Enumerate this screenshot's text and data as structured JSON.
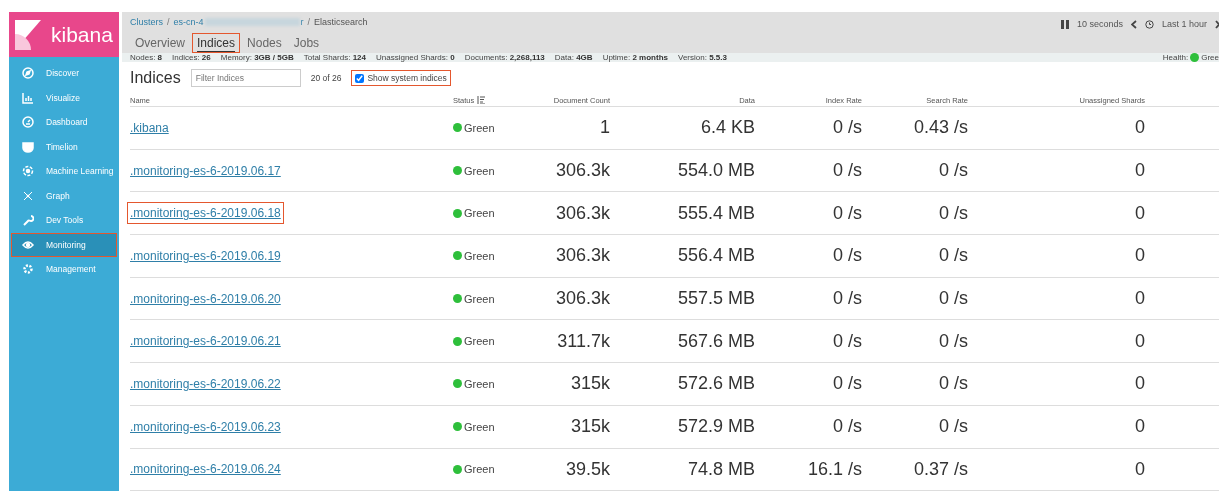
{
  "sidebar": {
    "logo": "kibana",
    "items": [
      {
        "label": "Discover",
        "selected": false,
        "highlighted": false
      },
      {
        "label": "Visualize",
        "selected": false,
        "highlighted": false
      },
      {
        "label": "Dashboard",
        "selected": false,
        "highlighted": false
      },
      {
        "label": "Timelion",
        "selected": false,
        "highlighted": false
      },
      {
        "label": "Machine Learning",
        "selected": false,
        "highlighted": false
      },
      {
        "label": "Graph",
        "selected": false,
        "highlighted": false
      },
      {
        "label": "Dev Tools",
        "selected": false,
        "highlighted": false
      },
      {
        "label": "Monitoring",
        "selected": true,
        "highlighted": true
      },
      {
        "label": "Management",
        "selected": false,
        "highlighted": false
      }
    ]
  },
  "breadcrumbs": [
    {
      "label": "Clusters",
      "kind": "link"
    },
    {
      "separator": "/",
      "label": "es-cn-4",
      "suffix": "r",
      "kind": "redacted"
    },
    {
      "separator": "/",
      "label": "Elasticsearch",
      "kind": "current"
    }
  ],
  "tabs": [
    {
      "label": "Overview",
      "selected": false,
      "highlighted": false
    },
    {
      "label": "Indices",
      "selected": true,
      "highlighted": true
    },
    {
      "label": "Nodes",
      "selected": false,
      "highlighted": false
    },
    {
      "label": "Jobs",
      "selected": false,
      "highlighted": false
    }
  ],
  "time_controls": {
    "refresh": "10 seconds",
    "range": "Last 1 hour"
  },
  "stats": [
    {
      "label": "Nodes:",
      "value": "8"
    },
    {
      "label": "Indices:",
      "value": "26"
    },
    {
      "label": "Memory:",
      "value": "3GB / 5GB"
    },
    {
      "label": "Total Shards:",
      "value": "124"
    },
    {
      "label": "Unassigned Shards:",
      "value": "0"
    },
    {
      "label": "Documents:",
      "value": "2,268,113"
    },
    {
      "label": "Data:",
      "value": "4GB"
    },
    {
      "label": "Uptime:",
      "value": "2 months"
    },
    {
      "label": "Version:",
      "value": "5.5.3"
    }
  ],
  "health": {
    "label": "Health:",
    "value": "Gree",
    "color": "#2ebf3b"
  },
  "indices": {
    "title": "Indices",
    "filter": {
      "placeholder": "Filter Indices"
    },
    "count": "20 of 26",
    "system_toggle": {
      "label": "Show system indices",
      "checked": true,
      "highlighted": true
    },
    "columns": [
      "Name",
      "Status",
      "Document Count",
      "Data",
      "Index Rate",
      "Search Rate",
      "Unassigned Shards"
    ],
    "rows": [
      {
        "name": ".kibana",
        "status": "Green",
        "color": "#2ebf3b",
        "docs": "1",
        "data": "6.4 KB",
        "index_rate": "0 /s",
        "search_rate": "0.43 /s",
        "unassigned": "0",
        "highlighted": false
      },
      {
        "name": ".monitoring-es-6-2019.06.17",
        "status": "Green",
        "color": "#2ebf3b",
        "docs": "306.3k",
        "data": "554.0 MB",
        "index_rate": "0 /s",
        "search_rate": "0 /s",
        "unassigned": "0",
        "highlighted": false
      },
      {
        "name": ".monitoring-es-6-2019.06.18",
        "status": "Green",
        "color": "#2ebf3b",
        "docs": "306.3k",
        "data": "555.4 MB",
        "index_rate": "0 /s",
        "search_rate": "0 /s",
        "unassigned": "0",
        "highlighted": true
      },
      {
        "name": ".monitoring-es-6-2019.06.19",
        "status": "Green",
        "color": "#2ebf3b",
        "docs": "306.3k",
        "data": "556.4 MB",
        "index_rate": "0 /s",
        "search_rate": "0 /s",
        "unassigned": "0",
        "highlighted": false
      },
      {
        "name": ".monitoring-es-6-2019.06.20",
        "status": "Green",
        "color": "#2ebf3b",
        "docs": "306.3k",
        "data": "557.5 MB",
        "index_rate": "0 /s",
        "search_rate": "0 /s",
        "unassigned": "0",
        "highlighted": false
      },
      {
        "name": ".monitoring-es-6-2019.06.21",
        "status": "Green",
        "color": "#2ebf3b",
        "docs": "311.7k",
        "data": "567.6 MB",
        "index_rate": "0 /s",
        "search_rate": "0 /s",
        "unassigned": "0",
        "highlighted": false
      },
      {
        "name": ".monitoring-es-6-2019.06.22",
        "status": "Green",
        "color": "#2ebf3b",
        "docs": "315k",
        "data": "572.6 MB",
        "index_rate": "0 /s",
        "search_rate": "0 /s",
        "unassigned": "0",
        "highlighted": false
      },
      {
        "name": ".monitoring-es-6-2019.06.23",
        "status": "Green",
        "color": "#2ebf3b",
        "docs": "315k",
        "data": "572.9 MB",
        "index_rate": "0 /s",
        "search_rate": "0 /s",
        "unassigned": "0",
        "highlighted": false
      },
      {
        "name": ".monitoring-es-6-2019.06.24",
        "status": "Green",
        "color": "#2ebf3b",
        "docs": "39.5k",
        "data": "74.8 MB",
        "index_rate": "16.1 /s",
        "search_rate": "0.37 /s",
        "unassigned": "0",
        "highlighted": false
      }
    ]
  }
}
